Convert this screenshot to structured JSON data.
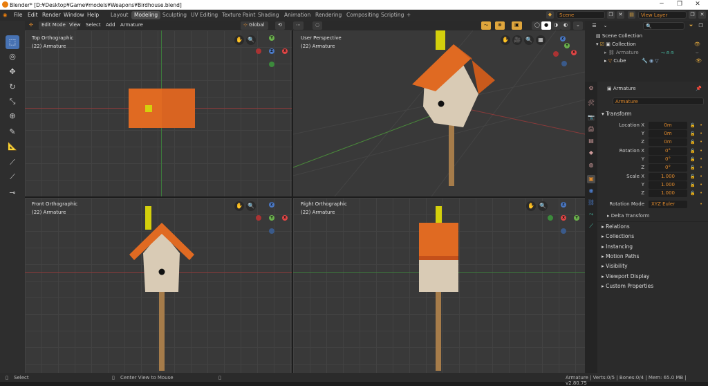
{
  "window": {
    "title": "Blender* [D:¥Desktop¥Game¥models¥Weapons¥Birdhouse.blend]"
  },
  "menus": [
    "File",
    "Edit",
    "Render",
    "Window",
    "Help"
  ],
  "workspaces": [
    "Layout",
    "Modeling",
    "Sculpting",
    "UV Editing",
    "Texture Paint",
    "Shading",
    "Animation",
    "Rendering",
    "Compositing",
    "Scripting"
  ],
  "active_workspace": "Modeling",
  "scene": "Scene",
  "view_layer": "View Layer",
  "viewport_header": {
    "mode": "Edit Mode",
    "menus": [
      "View",
      "Select",
      "Add",
      "Armature"
    ],
    "orientation": "Global"
  },
  "viewports": [
    {
      "name": "Top Orthographic",
      "object": "(22) Armature"
    },
    {
      "name": "User Perspective",
      "object": "(22) Armature"
    },
    {
      "name": "Front Orthographic",
      "object": "(22) Armature"
    },
    {
      "name": "Right Orthographic",
      "object": "(22) Armature"
    }
  ],
  "outliner": {
    "root": "Scene Collection",
    "collection": "Collection",
    "items": [
      "Armature",
      "Cube"
    ]
  },
  "properties": {
    "object_name": "Armature",
    "data_name": "Armature",
    "transform_label": "Transform",
    "location_label": "Location X",
    "rotation_label": "Rotation X",
    "scale_label": "Scale X",
    "y_label": "Y",
    "z_label": "Z",
    "location": [
      "0m",
      "0m",
      "0m"
    ],
    "rotation": [
      "0°",
      "0°",
      "0°"
    ],
    "scale": [
      "1.000",
      "1.000",
      "1.000"
    ],
    "rotation_mode_label": "Rotation Mode",
    "rotation_mode": "XYZ Euler",
    "delta_transform": "Delta Transform",
    "sections": [
      "Relations",
      "Collections",
      "Instancing",
      "Motion Paths",
      "Visibility",
      "Viewport Display",
      "Custom Properties"
    ]
  },
  "statusbar": {
    "left": "Select",
    "middle": "Center View to Mouse",
    "right": "Armature | Verts:0/5 | Bones:0/4 | Mem: 65.0 MB | v2.80.75"
  },
  "colors": {
    "accent": "#e08a2c",
    "active_tool": "#4772b3",
    "roof": "#e06a22",
    "walls": "#d9cbb5",
    "pole": "#a67c4a",
    "chimney": "#d4d00c"
  }
}
